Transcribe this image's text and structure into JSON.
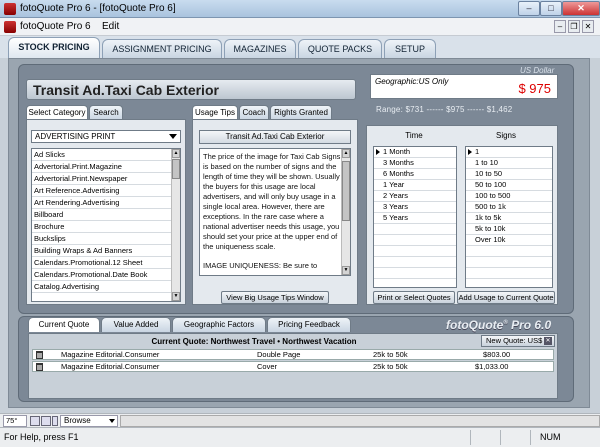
{
  "window": {
    "title": "fotoQuote Pro 6 - [fotoQuote Pro 6]",
    "minimize": "–",
    "maximize": "□",
    "close": "✕"
  },
  "menubar": {
    "app_label": "fotoQuote Pro 6",
    "edit": "Edit",
    "mdi_minimize": "–",
    "mdi_restore": "❐",
    "mdi_close": "✕"
  },
  "main_tabs": [
    "STOCK PRICING",
    "ASSIGNMENT PRICING",
    "MAGAZINES",
    "QUOTE PACKS",
    "SETUP"
  ],
  "header": {
    "title": "Transit Ad.Taxi Cab Exterior",
    "currency": "US Dollar",
    "geographic": "Geographic:US Only",
    "price": "$ 975",
    "range_label": "Range:",
    "range_low": "$731",
    "range_mid": "$975",
    "range_high": "$1,462",
    "range_sep": "------"
  },
  "category_panel": {
    "tabs": [
      "Select Category",
      "Search"
    ],
    "dropdown": "ADVERTISING PRINT",
    "items": [
      "Ad Slicks",
      "Advertorial.Print.Magazine",
      "Advertorial.Print.Newspaper",
      "Art Reference.Advertising",
      "Art Rendering.Advertising",
      "Billboard",
      "Brochure",
      "Buckslips",
      "Building Wraps & Ad Banners",
      "Calendars.Promotional.12 Sheet",
      "Calendars.Promotional.Date Book",
      "Catalog.Advertising"
    ]
  },
  "usage_panel": {
    "tabs": [
      "Usage Tips",
      "Coach",
      "Rights Granted"
    ],
    "heading": "Transit Ad.Taxi Cab Exterior",
    "text": "The price of the image for Taxi Cab Signs is based on the number of signs and the length of time they will be shown. Usually the buyers for this usage are local advertisers, and will only buy usage in a single local area. However, there are exceptions. In the rare case where a national advertiser needs this usage, you should set your price at the upper end of the uniqueness scale.",
    "text2": "IMAGE UNIQUENESS: Be sure to",
    "button": "View Big Usage Tips Window"
  },
  "time_signs": {
    "time_header": "Time",
    "signs_header": "Signs",
    "time": [
      "1 Month",
      "3 Months",
      "6 Months",
      "1 Year",
      "2 Years",
      "3 Years",
      "5 Years"
    ],
    "signs": [
      "1",
      "1 to 10",
      "10 to 50",
      "50 to 100",
      "100 to 500",
      "500 to 1k",
      "1k to 5k",
      "5k to 10k",
      "Over 10k"
    ],
    "print_button": "Print or Select Quotes",
    "add_button": "Add Usage to Current Quote"
  },
  "lower": {
    "tabs": [
      "Current Quote",
      "Value Added",
      "Geographic Factors",
      "Pricing Feedback"
    ],
    "logo": "fotoQuote",
    "logo_reg": "®",
    "logo_pro": "Pro 6.0",
    "current_quote": "Current Quote: Northwest Travel  •  Northwest Vacation",
    "new_quote": "New Quote: US$",
    "rows": [
      {
        "category": "Magazine Editorial.Consumer",
        "usage": "Double Page",
        "range": "25k to 50k",
        "price": "$803.00"
      },
      {
        "category": "Magazine Editorial.Consumer",
        "usage": "Cover",
        "range": "25k to 50k",
        "price": "$1,033.00"
      }
    ]
  },
  "status": {
    "zoom": "75°",
    "browse": "Browse",
    "help": "For Help, press F1",
    "num": "NUM"
  }
}
